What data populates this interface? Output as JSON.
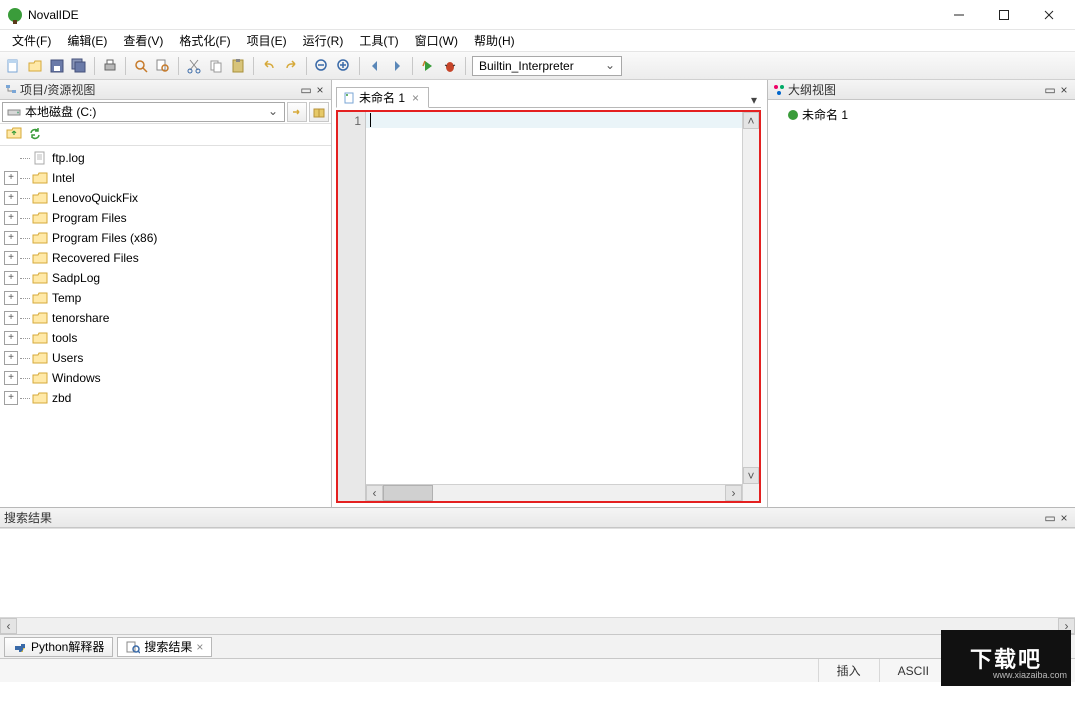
{
  "app": {
    "title": "NovalIDE"
  },
  "menu": {
    "file": "文件(F)",
    "edit": "编辑(E)",
    "view": "查看(V)",
    "format": "格式化(F)",
    "project": "项目(E)",
    "run": "运行(R)",
    "tools": "工具(T)",
    "window": "窗口(W)",
    "help": "帮助(H)"
  },
  "toolbar": {
    "interpreter": "Builtin_Interpreter"
  },
  "leftPanel": {
    "title": "项目/资源视图",
    "drive": "本地磁盘 (C:)",
    "tree": [
      {
        "name": "ftp.log",
        "type": "file",
        "exp": ""
      },
      {
        "name": "Intel",
        "type": "folder",
        "exp": "+"
      },
      {
        "name": "LenovoQuickFix",
        "type": "folder",
        "exp": "+"
      },
      {
        "name": "Program Files",
        "type": "folder",
        "exp": "+"
      },
      {
        "name": "Program Files (x86)",
        "type": "folder",
        "exp": "+"
      },
      {
        "name": "Recovered Files",
        "type": "folder",
        "exp": "+"
      },
      {
        "name": "SadpLog",
        "type": "folder",
        "exp": "+"
      },
      {
        "name": "Temp",
        "type": "folder",
        "exp": "+"
      },
      {
        "name": "tenorshare",
        "type": "folder",
        "exp": "+"
      },
      {
        "name": "tools",
        "type": "folder",
        "exp": "+"
      },
      {
        "name": "Users",
        "type": "folder",
        "exp": "+"
      },
      {
        "name": "Windows",
        "type": "folder",
        "exp": "+"
      },
      {
        "name": "zbd",
        "type": "folder",
        "exp": "+"
      }
    ]
  },
  "editor": {
    "tab": "未命名 1",
    "lineNumber": "1"
  },
  "outline": {
    "title": "大纲视图",
    "item": "未命名 1"
  },
  "search": {
    "title": "搜索结果"
  },
  "bottomTabs": {
    "python": "Python解释器",
    "search": "搜索结果"
  },
  "status": {
    "insert": "插入",
    "encoding": "ASCII"
  },
  "watermark": "www.xiazaiba.com",
  "bigLogo": "下载吧"
}
